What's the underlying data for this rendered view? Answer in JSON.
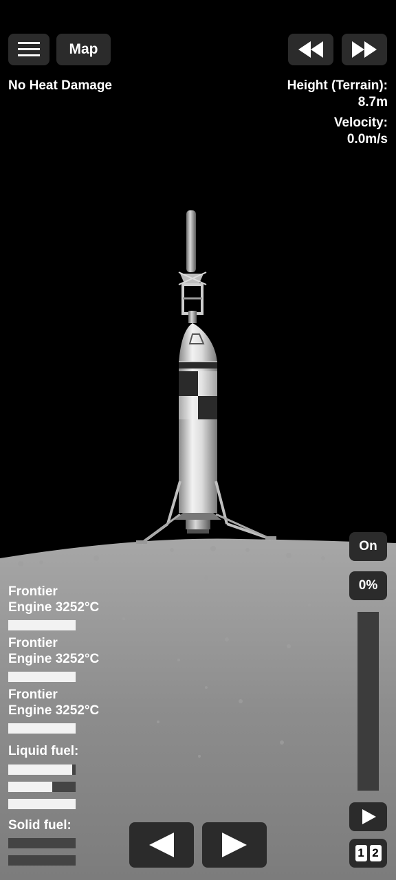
{
  "hud": {
    "map_label": "Map",
    "heat_status": "No Heat Damage",
    "height_label": "Height (Terrain):",
    "height_value": "8.7m",
    "velocity_label": "Velocity:",
    "velocity_value": "0.0m/s",
    "engine_toggle": "On",
    "throttle_percent": "0%",
    "throttle_level": 0,
    "stage_numbers": [
      "1",
      "2"
    ]
  },
  "engines": [
    {
      "line1": "Frontier",
      "line2": "Engine 3252°C",
      "health": 1.0
    },
    {
      "line1": "Frontier",
      "line2": "Engine 3252°C",
      "health": 1.0
    },
    {
      "line1": "Frontier",
      "line2": "Engine 3252°C",
      "health": 1.0
    }
  ],
  "fuel": {
    "liquid_label": "Liquid fuel:",
    "liquid_levels": [
      0.95,
      0.65,
      1.0
    ],
    "solid_label": "Solid fuel:",
    "solid_levels": [
      0,
      0
    ]
  },
  "icons": [
    "menu-icon",
    "rewind-icon",
    "fast-forward-icon",
    "rotate-left-icon",
    "rotate-right-icon",
    "play-icon"
  ],
  "colors": {
    "button_bg": "#2b2b2b",
    "ground": "#8f8f8f",
    "sky": "#000000"
  }
}
